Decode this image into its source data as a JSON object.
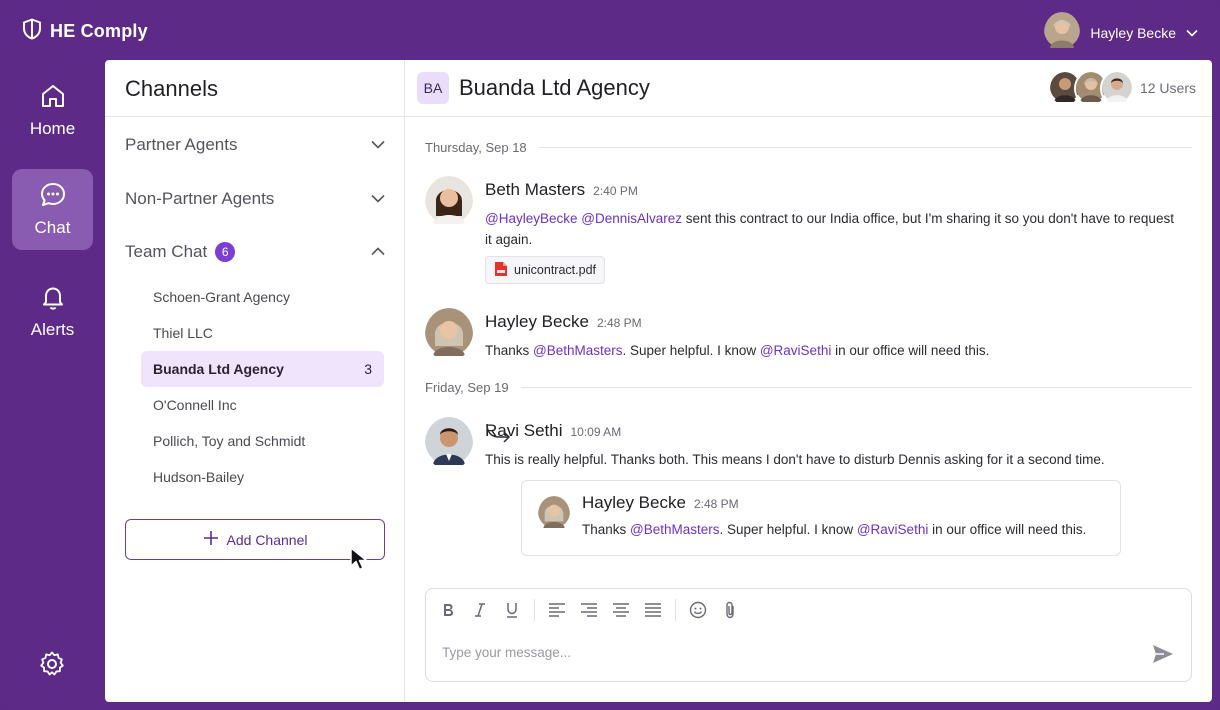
{
  "app": {
    "name": "HE Comply",
    "brand_icon": "shield-icon"
  },
  "user": {
    "name": "Hayley Becke",
    "menu_icon": "chevron-down-icon"
  },
  "nav": {
    "items": [
      {
        "label": "Home",
        "icon": "home-icon",
        "active": false
      },
      {
        "label": "Chat",
        "icon": "chat-bubble-icon",
        "active": true
      },
      {
        "label": "Alerts",
        "icon": "bell-icon",
        "active": false
      }
    ],
    "settings_icon": "gear-icon"
  },
  "channels": {
    "title": "Channels",
    "sections": [
      {
        "label": "Partner Agents",
        "expanded": false
      },
      {
        "label": "Non-Partner Agents",
        "expanded": false
      },
      {
        "label": "Team Chat",
        "badge": "6",
        "expanded": true
      }
    ],
    "items": [
      {
        "label": "Schoen-Grant Agency",
        "unread": ""
      },
      {
        "label": "Thiel LLC",
        "unread": ""
      },
      {
        "label": "Buanda Ltd Agency",
        "unread": "3",
        "active": true
      },
      {
        "label": "O'Connell Inc",
        "unread": ""
      },
      {
        "label": "Pollich, Toy and Schmidt",
        "unread": ""
      },
      {
        "label": "Hudson-Bailey",
        "unread": ""
      }
    ],
    "add_label": "Add Channel"
  },
  "chat": {
    "initials": "BA",
    "title": "Buanda Ltd Agency",
    "users_label": "12 Users",
    "dates": [
      "Thursday, Sep 18",
      "Friday, Sep 19"
    ],
    "messages": [
      {
        "author": "Beth Masters",
        "time": "2:40 PM",
        "mention_1": "@HayleyBecke",
        "mention_2": "@DennisAlvarez",
        "text_1": " sent this contract to our India office, but I'm sharing it so you don't have to request it again.",
        "attachment": "unicontract.pdf"
      },
      {
        "author": "Hayley Becke",
        "time": "2:48 PM",
        "text_1": "Thanks ",
        "mention_1": "@BethMasters",
        "text_2": ". Super helpful. I know ",
        "mention_2": "@RaviSethi",
        "text_3": " in our office will need this."
      },
      {
        "author": "Ravi Sethi",
        "time": "10:09 AM",
        "text_1": "This is really helpful. Thanks both. This means I don't have to disturb Dennis asking for it a second time."
      }
    ],
    "reply": {
      "author": "Hayley Becke",
      "time": "2:48 PM",
      "text_1": "Thanks ",
      "mention_1": "@BethMasters",
      "text_2": ". Super helpful. I know ",
      "mention_2": "@RaviSethi",
      "text_3": " in our office will need this."
    }
  },
  "composer": {
    "placeholder": "Type your message...",
    "tools": [
      "bold-icon",
      "italic-icon",
      "underline-icon",
      "align-left-icon",
      "align-right-icon",
      "align-center-icon",
      "align-justify-icon",
      "emoji-icon",
      "attachment-icon"
    ],
    "send_icon": "send-icon"
  },
  "colors": {
    "brand": "#5d2b87",
    "accent": "#7a3fd0",
    "mention": "#6b33c9",
    "active_channel_bg": "#efe4fb"
  }
}
